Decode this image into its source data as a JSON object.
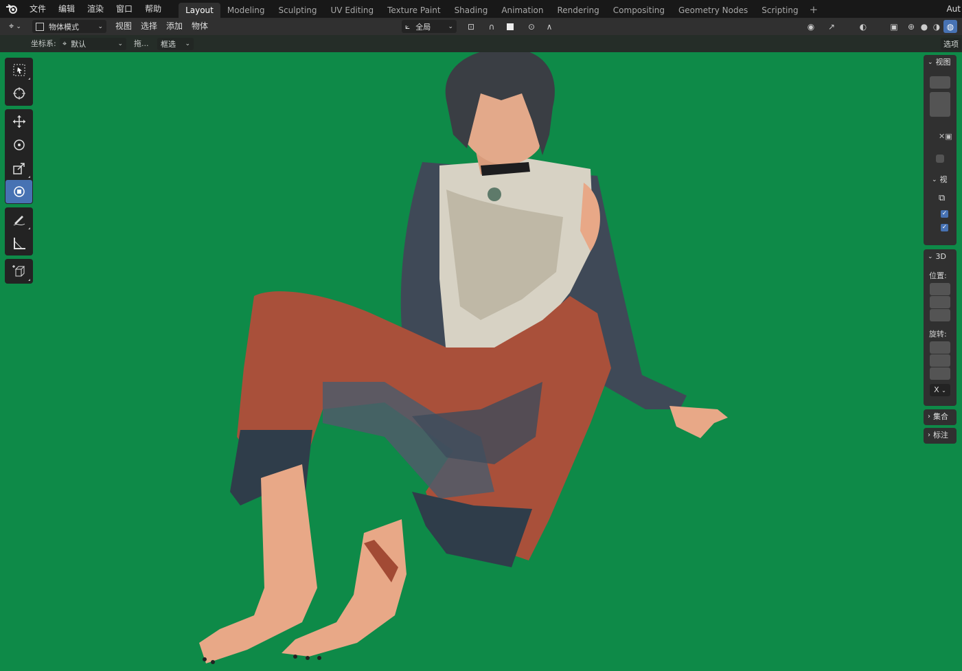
{
  "topbar": {
    "menu": [
      "文件",
      "编辑",
      "渲染",
      "窗口",
      "帮助"
    ],
    "tabs": [
      "Layout",
      "Modeling",
      "Sculpting",
      "UV Editing",
      "Texture Paint",
      "Shading",
      "Animation",
      "Rendering",
      "Compositing",
      "Geometry Nodes",
      "Scripting"
    ],
    "active_tab": "Layout",
    "add_tab": "+",
    "right_label": "Aut"
  },
  "header": {
    "mode": "物体模式",
    "menus": [
      "视图",
      "选择",
      "添加",
      "物体"
    ],
    "transform_orientation": "全局"
  },
  "subheader": {
    "coord_label": "坐标系:",
    "coord_value": "默认",
    "drag_label": "拖...",
    "select_value": "框选",
    "options": "选项"
  },
  "npanel": {
    "view_tab": "视图",
    "view_sub": "视",
    "transform_tab": "3D",
    "location_label": "位置:",
    "rotation_label": "旋转:",
    "rotation_mode": "X",
    "collection": "集合",
    "annotation": "标注"
  },
  "colors": {
    "viewport_bg": "#0e8a48",
    "accent": "#4772b3"
  }
}
